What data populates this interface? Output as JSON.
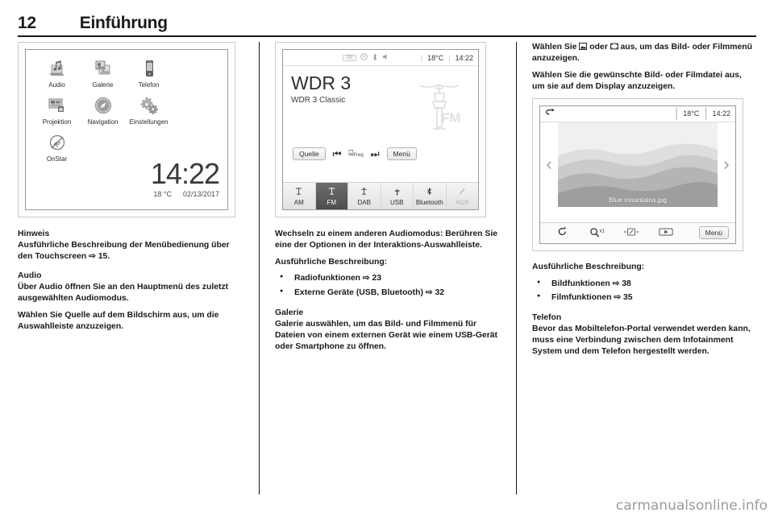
{
  "header": {
    "page_number": "12",
    "title": "Einführung"
  },
  "figures": {
    "home_screen": {
      "name": "home-screen",
      "tiles": [
        {
          "label": "Audio",
          "icon": "audio-icon"
        },
        {
          "label": "Galerie",
          "icon": "gallery-icon"
        },
        {
          "label": "Telefon",
          "icon": "phone-icon"
        },
        {
          "label": "Projektion",
          "icon": "projection-icon"
        },
        {
          "label": "Navigation",
          "icon": "navigation-icon"
        },
        {
          "label": "Einstellungen",
          "icon": "settings-gear-icon"
        },
        {
          "label": "OnStar",
          "icon": "onstar-icon"
        }
      ],
      "clock": "14:22",
      "temperature": "18 °C",
      "date": "02/13/2017"
    },
    "radio_screen": {
      "name": "radio-fm-screen",
      "status_icons": [
        "tp-icon",
        "clock-icon",
        "bluetooth-icon",
        "mute-icon"
      ],
      "tp_label": "TP",
      "temperature": "18°C",
      "time": "14:22",
      "separator": "|",
      "station": "WDR 3",
      "station_info": "WDR 3 Classic",
      "logo_text": "FM",
      "controls": [
        {
          "label": "Quelle",
          "icon": "source-button",
          "type": "button"
        },
        {
          "label": "",
          "icon": "skip-previous-icon",
          "glyph": "⏮",
          "type": "icon"
        },
        {
          "label": "Freq",
          "icon": "frequency-keypad-icon",
          "glyph": "⌸",
          "type": "icon"
        },
        {
          "label": "",
          "icon": "skip-next-icon",
          "glyph": "⏭",
          "type": "icon"
        },
        {
          "label": "Menü",
          "icon": "menu-button",
          "type": "button"
        }
      ],
      "sources": [
        {
          "label": "AM",
          "icon": "antenna-icon",
          "state": "normal"
        },
        {
          "label": "FM",
          "icon": "antenna-icon",
          "state": "active"
        },
        {
          "label": "DAB",
          "icon": "dab-antenna-icon",
          "state": "normal"
        },
        {
          "label": "USB",
          "icon": "usb-icon",
          "state": "normal"
        },
        {
          "label": "Bluetooth",
          "icon": "bluetooth-icon",
          "state": "normal"
        },
        {
          "label": "AUX",
          "icon": "aux-jack-icon",
          "state": "disabled"
        }
      ]
    },
    "gallery_screen": {
      "name": "gallery-image-screen",
      "back_icon": "back-arrow-icon",
      "temperature": "18°C",
      "time": "14:22",
      "separator": "|",
      "prev_icon": "chevron-left-icon",
      "next_icon": "chevron-right-icon",
      "image_caption": "Blue mountains.jpg",
      "tools": [
        {
          "label": "",
          "icon": "rotate-icon",
          "glyph": "↻"
        },
        {
          "label": "x1",
          "icon": "zoom-icon",
          "glyph": "⚲"
        },
        {
          "label": "",
          "icon": "fit-to-screen-icon",
          "glyph": "⤧"
        },
        {
          "label": "",
          "icon": "slideshow-play-icon",
          "glyph": "▶"
        },
        {
          "label": "Menü",
          "icon": "menu-button"
        }
      ]
    }
  },
  "columns": {
    "left": {
      "note_heading": "Hinweis",
      "note_text": "Ausführliche Beschreibung der Menübedienung über den Touchscreen",
      "note_ref": "15",
      "audio_heading": "Audio",
      "audio_p1": "Über Audio öffnen Sie an den Hauptmenü des zuletzt ausgewählten Audiomodus.",
      "audio_p2": "Wählen Sie Quelle auf dem Bildschirm aus, um die Auswahlleiste anzuzeigen."
    },
    "middle": {
      "p1": "Wechseln zu einem anderen Audiomodus: Berühren Sie eine der Optionen in der Interaktions-Auswahlleiste.",
      "desc_heading": "Ausführliche Beschreibung:",
      "bullets": [
        {
          "text": "Radiofunktionen",
          "ref": "23"
        },
        {
          "text": "Externe Geräte (USB, Bluetooth)",
          "ref": "32"
        }
      ],
      "gallery_heading": "Galerie",
      "gallery_p1": "Galerie auswählen, um das Bild- und Filmmenü für Dateien von einem externen Gerät wie einem USB-Gerät oder Smartphone zu öffnen."
    },
    "right": {
      "p1_a": "Wählen Sie",
      "p1_icon1": "picture-icon",
      "p1_b": "oder",
      "p1_icon2": "film-icon",
      "p1_c": "aus, um das Bild- oder Filmmenü anzuzeigen.",
      "p2": "Wählen Sie die gewünschte Bild- oder Filmdatei aus, um sie auf dem Display anzuzeigen.",
      "desc_heading": "Ausführliche Beschreibung:",
      "bullets": [
        {
          "text": "Bildfunktionen",
          "ref": "38"
        },
        {
          "text": "Filmfunktionen",
          "ref": "35"
        }
      ],
      "phone_heading": "Telefon",
      "phone_p1": "Bevor das Mobiltelefon-Portal verwendet werden kann, muss eine Verbindung zwischen dem Infotainment System und dem Telefon hergestellt werden."
    }
  },
  "watermark": "carmanualsonline.info",
  "ref_arrow": "⇨"
}
